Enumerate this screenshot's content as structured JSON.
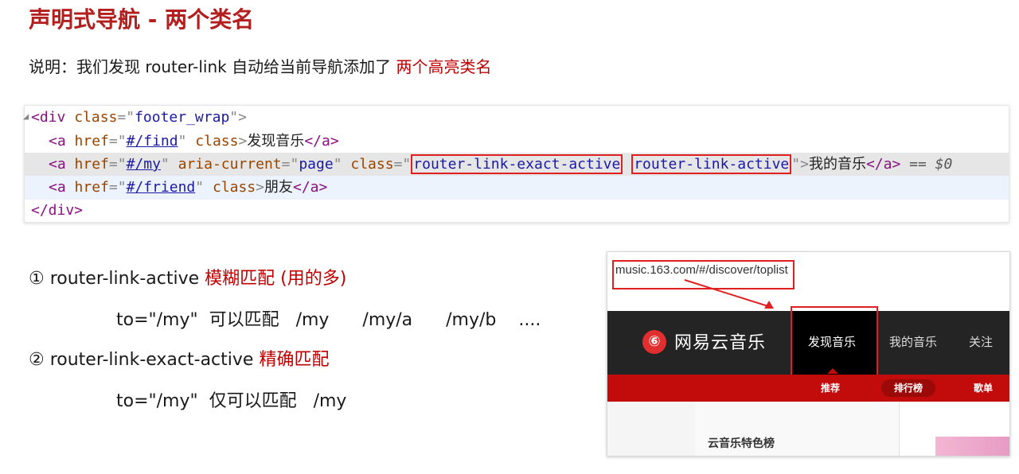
{
  "title": "声明式导航 - 两个类名",
  "desc": {
    "text": "说明：我们发现 router-link 自动给当前导航添加了 ",
    "highlight": "两个高亮类名"
  },
  "code": {
    "l1": {
      "open": "<div",
      "attr": " class",
      "eq": "=\"",
      "val": "footer_wrap",
      "close": "\">"
    },
    "l2": {
      "open": "<a",
      "href_attr": " href",
      "href_val": "#/find",
      "class_attr": " class",
      "text": "发现音乐",
      "close": "</a>"
    },
    "l3": {
      "open": "<a",
      "href_attr": " href",
      "href_val": "#/my",
      "aria_attr": " aria-current",
      "aria_val": "page",
      "class_attr": " class",
      "cls1": "router-link-exact-active",
      "cls2": "router-link-active",
      "text": "我的音乐",
      "close": "</a>",
      "eq_dollar": " == $0"
    },
    "l4": {
      "open": "<a",
      "href_attr": " href",
      "href_val": "#/friend",
      "class_attr": " class",
      "text": "朋友",
      "close": "</a>"
    },
    "l5": {
      "close": "</div>"
    }
  },
  "list": {
    "item1_main": "① router-link-active ",
    "item1_red": "模糊匹配 (用的多)",
    "item1_sub": "to=\"/my\"  可以匹配   /my      /my/a      /my/b    ....",
    "item2_main": "② router-link-exact-active ",
    "item2_red": "精确匹配",
    "item2_sub": "to=\"/my\"  仅可以匹配   /my"
  },
  "screenshot": {
    "url": "music.163.com/#/discover/toplist",
    "logo_glyph": "⑥",
    "logo_text": "网易云音乐",
    "nav": [
      "发现音乐",
      "我的音乐",
      "关注"
    ],
    "subnav": [
      "推荐",
      "排行榜",
      "歌单"
    ],
    "chart_title": "云音乐特色榜"
  },
  "colors": {
    "title_red": "#b31e1e",
    "highlight_red": "#c00000",
    "box_red": "#e02020",
    "nav_dark": "#242424",
    "subnav_red": "#c20c0c"
  }
}
